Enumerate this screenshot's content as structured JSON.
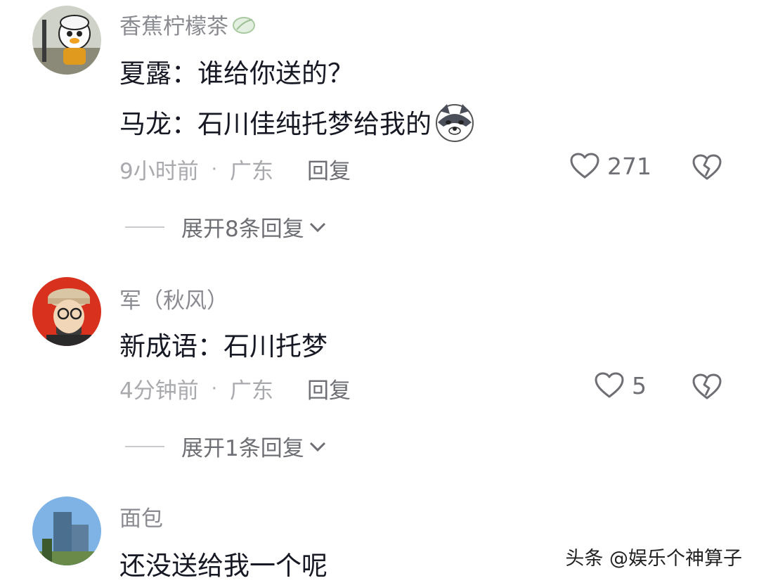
{
  "comments": [
    {
      "username": "香蕉柠檬茶",
      "lines": [
        "夏露：谁给你送的？",
        "马龙：石川佳纯托梦给我的"
      ],
      "time": "9小时前",
      "location": "广东",
      "reply_label": "回复",
      "likes": "271",
      "expand_label": "展开8条回复",
      "icons": [
        "leaf-icon",
        "wolf-emoji-icon"
      ]
    },
    {
      "username": "军（秋风）",
      "lines": [
        "新成语：石川托梦"
      ],
      "time": "4分钟前",
      "location": "广东",
      "reply_label": "回复",
      "likes": "5",
      "expand_label": "展开1条回复"
    },
    {
      "username": "面包",
      "lines": [
        "还没送给我一个呢"
      ]
    }
  ],
  "watermark": "头条 @娱乐个神算子",
  "colors": {
    "username": "#8a8b91",
    "text": "#161823",
    "meta": "#a9aaae"
  }
}
